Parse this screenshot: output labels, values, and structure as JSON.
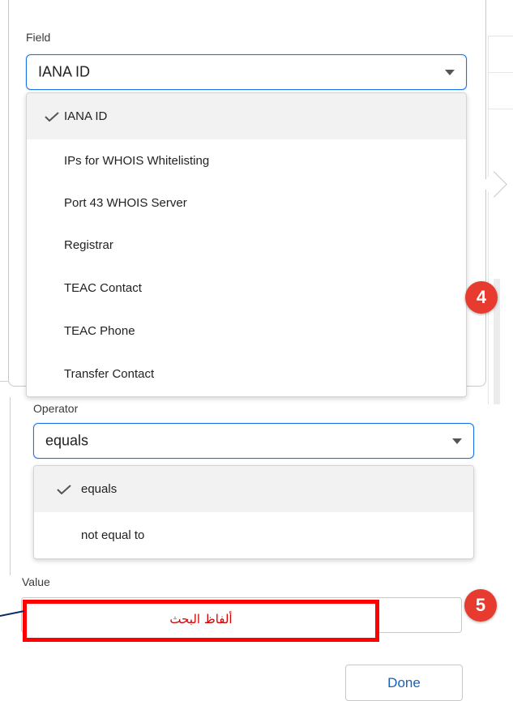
{
  "field": {
    "label": "Field",
    "selected_value": "IANA ID",
    "options": [
      {
        "label": "IANA ID",
        "selected": true
      },
      {
        "label": "IPs for WHOIS Whitelisting",
        "selected": false
      },
      {
        "label": "Port 43 WHOIS Server",
        "selected": false
      },
      {
        "label": "Registrar",
        "selected": false
      },
      {
        "label": "TEAC Contact",
        "selected": false
      },
      {
        "label": "TEAC Phone",
        "selected": false
      },
      {
        "label": "Transfer Contact",
        "selected": false
      }
    ]
  },
  "operator": {
    "label": "Operator",
    "selected_value": "equals",
    "options": [
      {
        "label": "equals",
        "selected": true
      },
      {
        "label": "not equal to",
        "selected": false
      }
    ]
  },
  "value": {
    "label": "Value",
    "annotation_text": "ألفاظ البحث"
  },
  "badges": {
    "step_4": "4",
    "step_5": "5"
  },
  "done_label": "Done",
  "colors": {
    "accent": "#1b73e8",
    "badge": "#e63b2e",
    "highlight": "#ff0000",
    "done_text": "#1b5fb8"
  },
  "icons": {
    "check": "check-icon",
    "caret": "chevron-down-icon"
  }
}
